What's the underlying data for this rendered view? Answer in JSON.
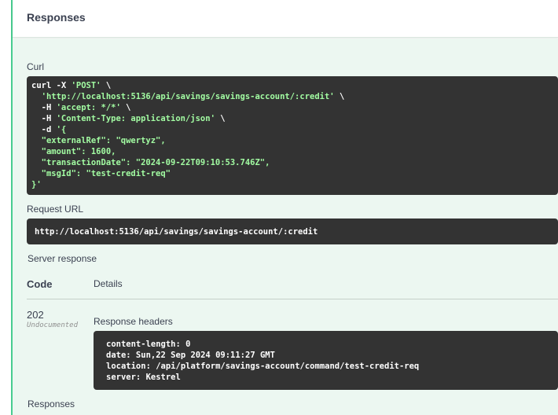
{
  "header": {
    "title": "Responses"
  },
  "curl": {
    "label": "Curl",
    "line1_prefix": "curl -X ",
    "line1_method": "'POST'",
    "line1_suffix": " \\",
    "line2_url": "'http://localhost:5136/api/savings/savings-account/:credit'",
    "line2_suffix": " \\",
    "line3_prefix": "  -H ",
    "line3_value": "'accept: */*'",
    "line3_suffix": " \\",
    "line4_prefix": "  -H ",
    "line4_value": "'Content-Type: application/json'",
    "line4_suffix": " \\",
    "line5_prefix": "  -d ",
    "line5_value": "'{",
    "body_lines": [
      "  \"externalRef\": \"qwertyz\",",
      "  \"amount\": 1600,",
      "  \"transactionDate\": \"2024-09-22T09:10:53.746Z\",",
      "  \"msgId\": \"test-credit-req\""
    ],
    "closing": "}'"
  },
  "request_url": {
    "label": "Request URL",
    "value": "http://localhost:5136/api/savings/savings-account/:credit"
  },
  "server_response": {
    "label": "Server response",
    "col_code": "Code",
    "col_details": "Details",
    "status_code": "202",
    "status_note": "Undocumented",
    "headers_label": "Response headers",
    "headers": [
      "content-length: 0",
      "date: Sun,22 Sep 2024 09:11:27 GMT",
      "location: /api/platform/savings-account/command/test-credit-req",
      "server: Kestrel"
    ]
  },
  "responses_footer": {
    "label": "Responses"
  },
  "colors": {
    "accent": "#49cc90",
    "panel_bg": "#ecf7f1",
    "code_bg": "#333333",
    "string": "#a2fca2"
  }
}
